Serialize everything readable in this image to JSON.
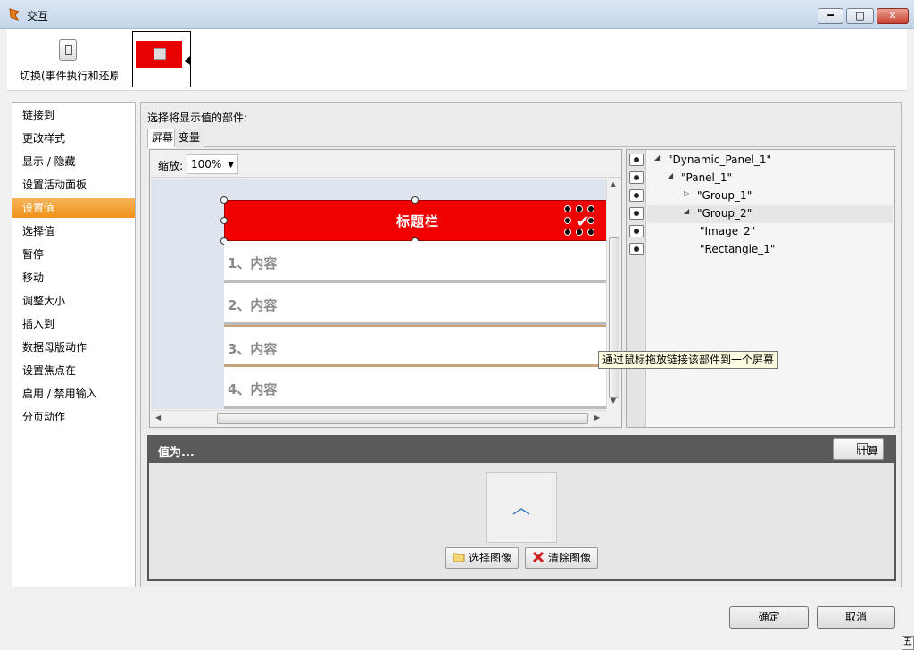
{
  "window": {
    "title": "交互",
    "min": "━",
    "max": "□",
    "close": "✕"
  },
  "toolbar": {
    "action_label": "切换(事件执行和还原"
  },
  "actions": [
    {
      "label": "链接到"
    },
    {
      "label": "更改样式"
    },
    {
      "label": "显示 / 隐藏"
    },
    {
      "label": "设置活动面板"
    },
    {
      "label": "设置值",
      "active": true
    },
    {
      "label": "选择值"
    },
    {
      "label": "暂停"
    },
    {
      "label": "移动"
    },
    {
      "label": "调整大小"
    },
    {
      "label": "插入到"
    },
    {
      "label": "数据母版动作"
    },
    {
      "label": "设置焦点在"
    },
    {
      "label": "启用 / 禁用输入"
    },
    {
      "label": "分页动作"
    }
  ],
  "main": {
    "section_label": "选择将显示值的部件:",
    "tabs": [
      {
        "label": "屏幕",
        "active": true
      },
      {
        "label": "变量"
      }
    ],
    "zoom": {
      "label": "缩放:",
      "value": "100%"
    },
    "widget": {
      "header_title": "标题栏",
      "rows": [
        "1、内容",
        "2、内容",
        "3、内容",
        "4、内容"
      ]
    },
    "tooltip": "通过鼠标拖放链接该部件到一个屏幕",
    "tree": [
      {
        "label": "\"Dynamic_Panel_1\"",
        "twisty": "◢"
      },
      {
        "label": "\"Panel_1\"",
        "twisty": "◢"
      },
      {
        "label": "\"Group_1\"",
        "twisty": "▷"
      },
      {
        "label": "\"Group_2\"",
        "twisty": "◢"
      },
      {
        "label": "\"Image_2\"",
        "twisty": ""
      },
      {
        "label": "\"Rectangle_1\"",
        "twisty": ""
      }
    ],
    "value_panel": {
      "title": "值为...",
      "calc_label": "计算",
      "choose_image": "选择图像",
      "clear_image": "清除图像"
    }
  },
  "footer": {
    "ok": "确定",
    "cancel": "取消",
    "corner": "五"
  }
}
